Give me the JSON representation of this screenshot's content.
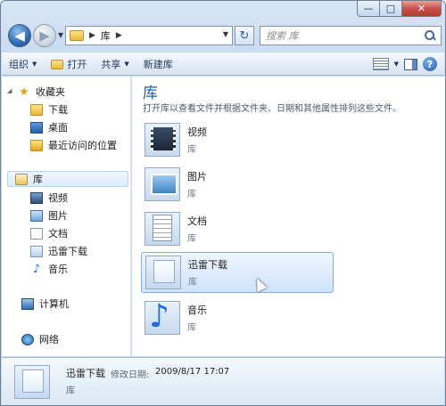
{
  "address": {
    "crumb": "库"
  },
  "search": {
    "placeholder": "搜索 库"
  },
  "toolbar": {
    "organize": "组织",
    "open": "打开",
    "share": "共享",
    "new_library": "新建库"
  },
  "nav": {
    "favorites": "收藏夹",
    "downloads": "下载",
    "desktop": "桌面",
    "recent": "最近访问的位置",
    "libraries": "库",
    "video": "视频",
    "pictures": "图片",
    "documents": "文档",
    "xunlei": "迅雷下载",
    "music": "音乐",
    "computer": "计算机",
    "network": "网络"
  },
  "content": {
    "title": "库",
    "subtitle": "打开库以查看文件并根据文件夹、日期和其他属性排列这些文件。",
    "items": [
      {
        "name": "视频",
        "type": "库"
      },
      {
        "name": "图片",
        "type": "库"
      },
      {
        "name": "文档",
        "type": "库"
      },
      {
        "name": "迅雷下载",
        "type": "库"
      },
      {
        "name": "音乐",
        "type": "库"
      }
    ]
  },
  "details": {
    "name": "迅雷下载",
    "modified_label": "修改日期:",
    "modified_value": "2009/8/17 17:07",
    "type": "库"
  }
}
